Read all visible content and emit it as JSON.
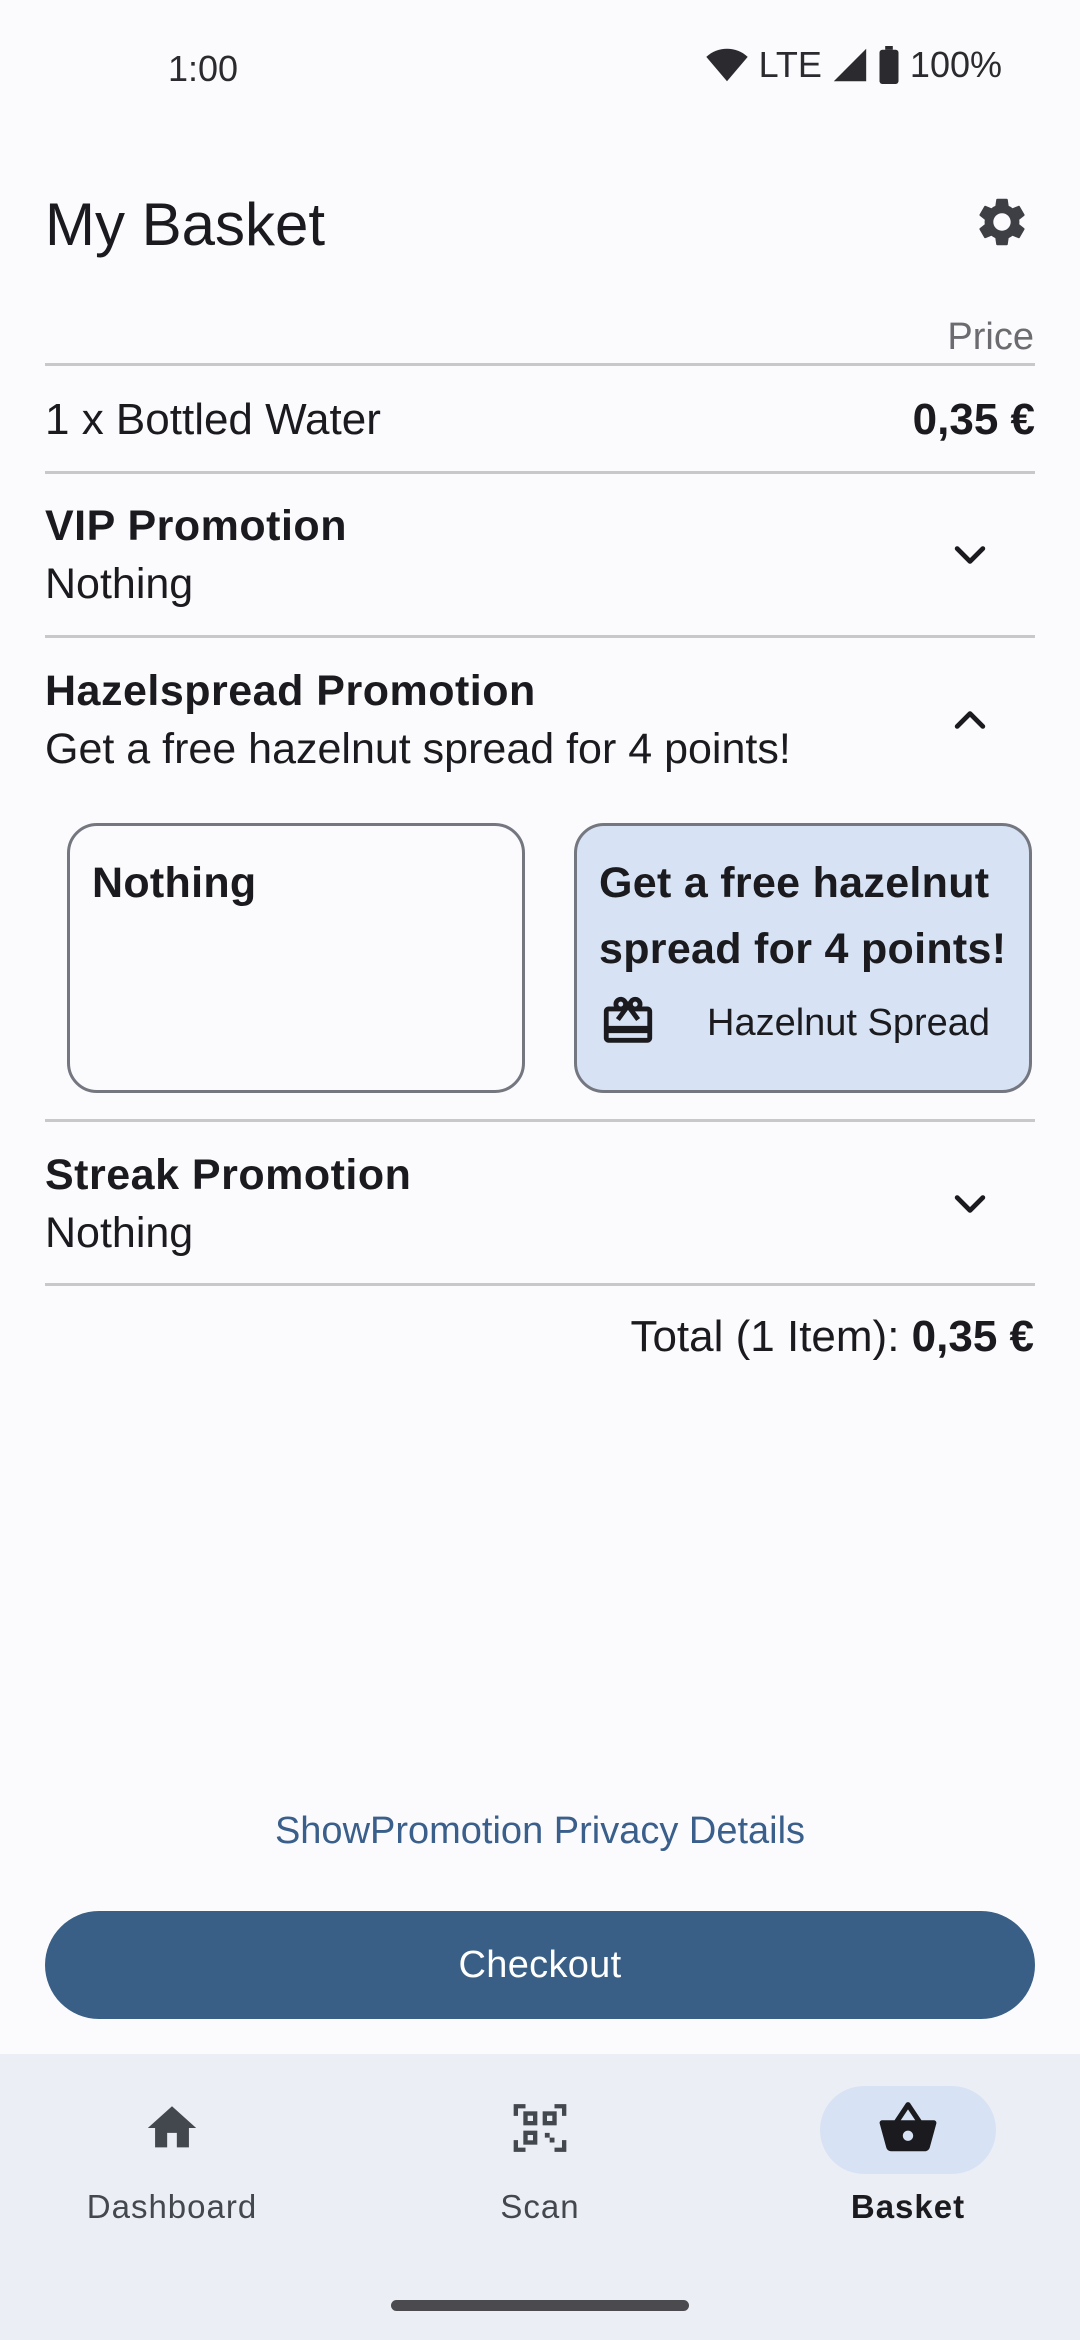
{
  "status_bar": {
    "time": "1:00",
    "network": "LTE",
    "battery": "100%"
  },
  "header": {
    "title": "My Basket",
    "settings_icon": "gear-icon"
  },
  "basket": {
    "price_column_label": "Price",
    "items": [
      {
        "label": "1 x Bottled Water",
        "price": "0,35 €"
      }
    ]
  },
  "promotions": {
    "vip": {
      "title": "VIP Promotion",
      "selection": "Nothing",
      "expanded": false
    },
    "hazelspread": {
      "title": "Hazelspread Promotion",
      "selection": "Get a free hazelnut spread for 4 points!",
      "expanded": true,
      "options": [
        {
          "title": "Nothing",
          "selected": false
        },
        {
          "title": "Get a free hazelnut spread for 4 points!",
          "reward_icon": "gift-card-icon",
          "reward": "Hazelnut Spread",
          "selected": true
        }
      ]
    },
    "streak": {
      "title": "Streak Promotion",
      "selection": "Nothing",
      "expanded": false
    }
  },
  "total": {
    "label": "Total (1 Item):",
    "amount": "0,35 €"
  },
  "privacy_link": "ShowPromotion Privacy Details",
  "checkout_label": "Checkout",
  "nav": {
    "items": [
      {
        "label": "Dashboard",
        "icon": "home-icon",
        "active": false
      },
      {
        "label": "Scan",
        "icon": "qr-scan-icon",
        "active": false
      },
      {
        "label": "Basket",
        "icon": "basket-icon",
        "active": true
      }
    ]
  },
  "colors": {
    "primary": "#3a5f86",
    "selected_card": "#d7e3f4",
    "nav_background": "#eceef5",
    "background": "#fbfbfe"
  }
}
